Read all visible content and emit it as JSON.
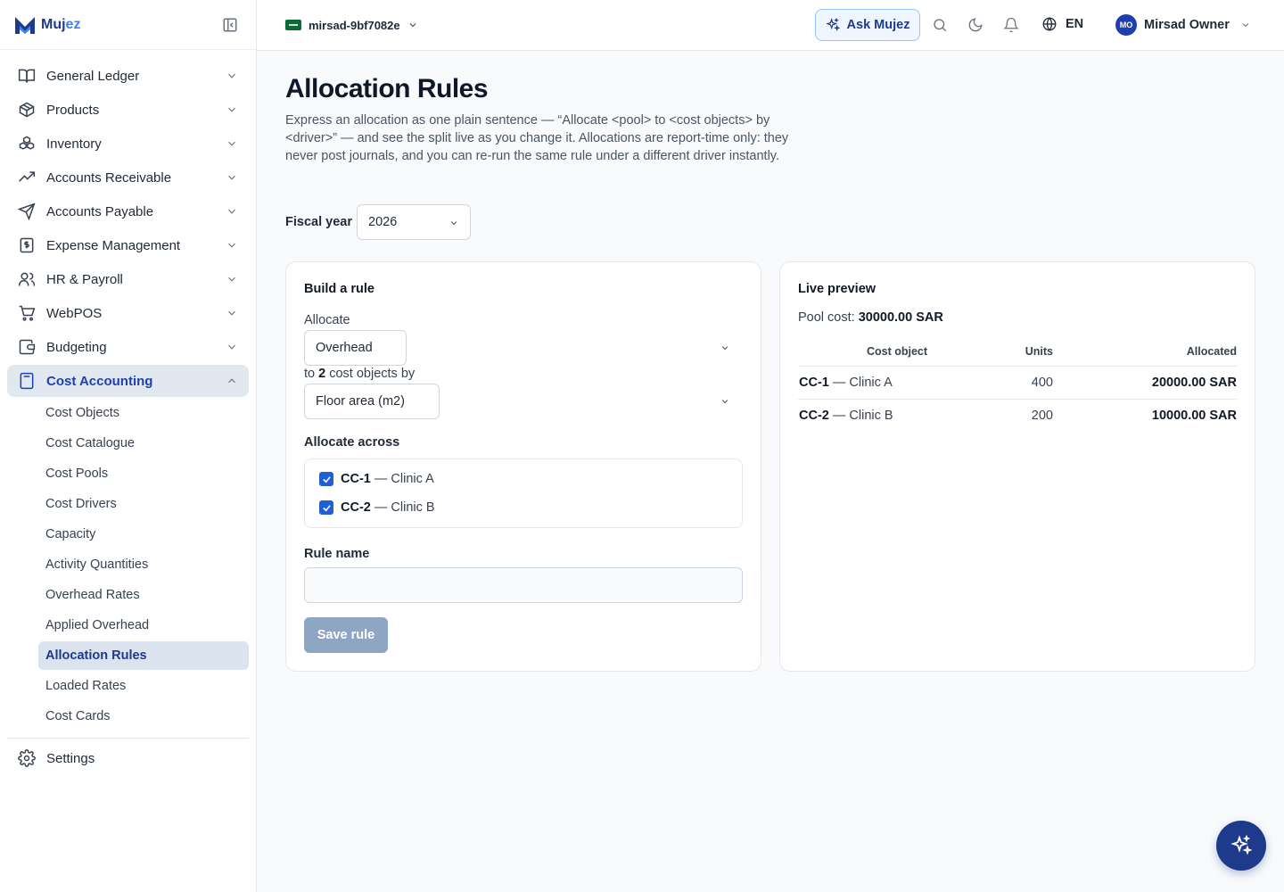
{
  "brand": {
    "name_part1": "Muj",
    "name_part2": "ez"
  },
  "topbar": {
    "workspace": "mirsad-9bf7082e",
    "ask_label": "Ask Mujez",
    "language": "EN",
    "user_initials": "MO",
    "user_name": "Mirsad Owner"
  },
  "sidebar": {
    "items": [
      {
        "label": "General Ledger",
        "icon": "book-open-icon"
      },
      {
        "label": "Products",
        "icon": "package-icon"
      },
      {
        "label": "Inventory",
        "icon": "boxes-icon"
      },
      {
        "label": "Accounts Receivable",
        "icon": "trending-up-icon"
      },
      {
        "label": "Accounts Payable",
        "icon": "send-icon"
      },
      {
        "label": "Expense Management",
        "icon": "receipt-icon"
      },
      {
        "label": "HR & Payroll",
        "icon": "users-icon"
      },
      {
        "label": "WebPOS",
        "icon": "cart-icon"
      },
      {
        "label": "Budgeting",
        "icon": "wallet-icon"
      },
      {
        "label": "Cost Accounting",
        "icon": "calculator-icon"
      }
    ],
    "sub_items": [
      "Cost Objects",
      "Cost Catalogue",
      "Cost Pools",
      "Cost Drivers",
      "Capacity",
      "Activity Quantities",
      "Overhead Rates",
      "Applied Overhead",
      "Allocation Rules",
      "Loaded Rates",
      "Cost Cards"
    ],
    "settings": "Settings"
  },
  "page": {
    "title": "Allocation Rules",
    "description": "Express an allocation as one plain sentence — “Allocate <pool> to <cost objects> by <driver>” — and see the split live as you change it. Allocations are report-time only: they never post journals, and you can re-run the same rule under a different driver instantly.",
    "fiscal_year_label": "Fiscal year",
    "fiscal_year": "2026"
  },
  "build": {
    "title": "Build a rule",
    "allocate_label": "Allocate",
    "pool": "Overhead",
    "to_prefix": "to ",
    "object_count": "2",
    "to_suffix": " cost objects by",
    "driver": "Floor area (m2)",
    "across_label": "Allocate across",
    "objects": [
      {
        "code": "CC-1",
        "name": " — Clinic A",
        "checked": true
      },
      {
        "code": "CC-2",
        "name": " — Clinic B",
        "checked": true
      }
    ],
    "rule_name_label": "Rule name",
    "rule_name_value": "",
    "save_label": "Save rule"
  },
  "preview": {
    "title": "Live preview",
    "pool_cost_label": "Pool cost: ",
    "pool_cost": "30000.00 SAR",
    "columns": [
      "Cost object",
      "Units",
      "Allocated"
    ],
    "rows": [
      {
        "code": "CC-1",
        "name": " — Clinic A",
        "units": "400",
        "allocated": "20000.00 SAR"
      },
      {
        "code": "CC-2",
        "name": " — Clinic B",
        "units": "200",
        "allocated": "10000.00 SAR"
      }
    ]
  },
  "colors": {
    "brand": "#1e3a8a",
    "accent": "#1e5fd6",
    "active_bg": "#e2e8f0"
  }
}
